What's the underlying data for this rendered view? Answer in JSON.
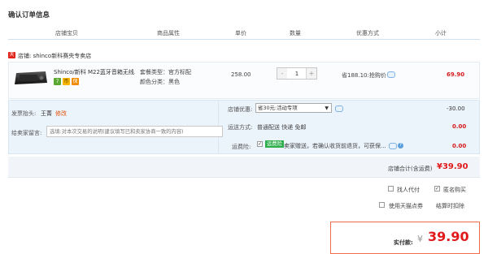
{
  "page": {
    "title": "确认订单信息"
  },
  "columns": {
    "store_item": "店铺宝贝",
    "attributes": "商品属性",
    "unit_price": "单价",
    "quantity": "数量",
    "promotion": "优惠方式",
    "subtotal": "小计"
  },
  "store": {
    "name_prefix": "店铺:",
    "name": "shinco新科赛央专卖店",
    "icon_label": "天"
  },
  "item": {
    "title": "Shinco/新科 M22蓝牙音箱无线...",
    "badges": [
      "7",
      "币",
      "保"
    ],
    "attr_type": "套餐类型：官方标配",
    "attr_color": "颜色分类：黑色",
    "price": "258.00",
    "quantity": "1",
    "minus": "-",
    "plus": "+",
    "promo": "省188.10:抢购价",
    "subtotal": "69.90"
  },
  "invoice": {
    "label": "发票抬头:",
    "value": "王菁",
    "edit": "修改"
  },
  "message": {
    "label": "给卖家留言:",
    "placeholder": "选填:对本次交易的说明(建议填写已和卖家协商一致的内容)"
  },
  "store_promo": {
    "label": "店铺优惠:",
    "selected": "省30元:活动专项",
    "caret": "▼",
    "value": "-30.00"
  },
  "shipping": {
    "label": "运送方式:",
    "option": "普通配送 快递 免邮",
    "value": "0.00"
  },
  "insurance": {
    "label": "运费险:",
    "checked_mark": "✓",
    "tag": "运费险",
    "text": "卖家赠送，若确认收货前退货，可获保...",
    "help": "?",
    "value": "0.00"
  },
  "store_total": {
    "label": "店铺合计(含运费)",
    "value": "¥39.90"
  },
  "options": {
    "proxy_pay": "找人代付",
    "anonymous": "匿名购买",
    "tmall_points": "使用天猫点券",
    "settle_later": "结算时扣除",
    "check_mark": "✓"
  },
  "payment": {
    "label": "实付款:",
    "currency": "¥",
    "value": "39.90"
  },
  "colors": {
    "accent_red": "#e0191b",
    "insurance_green": "#2eae4a",
    "panel_blue": "#ebf3fb",
    "pay_border": "#f16d4c"
  }
}
